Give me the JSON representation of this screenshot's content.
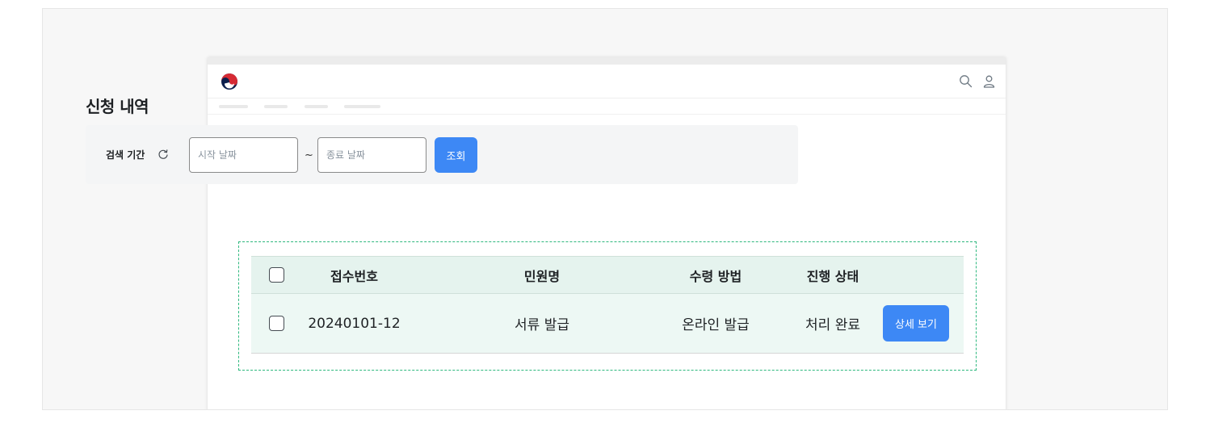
{
  "page": {
    "title": "신청 내역"
  },
  "filter": {
    "label": "검색 기간",
    "start_placeholder": "시작 날짜",
    "separator": "~",
    "end_placeholder": "종료 날짜",
    "search_label": "조회"
  },
  "table": {
    "headers": {
      "number": "접수번호",
      "name": "민원명",
      "method": "수령 방법",
      "status": "진행 상태"
    },
    "rows": [
      {
        "number": "20240101-12",
        "name": "서류 발급",
        "method": "온라인 발급",
        "status": "처리 완료",
        "action_label": "상세 보기"
      }
    ]
  },
  "icons": {
    "logo": "taegeuk-logo-icon",
    "search": "search-icon",
    "user": "user-icon",
    "reset": "refresh-icon"
  },
  "colors": {
    "primary": "#3d88f5",
    "table_header_bg": "#e5f3ee",
    "table_row_bg": "#edf8f4",
    "selection_outline": "#2eb87e"
  }
}
